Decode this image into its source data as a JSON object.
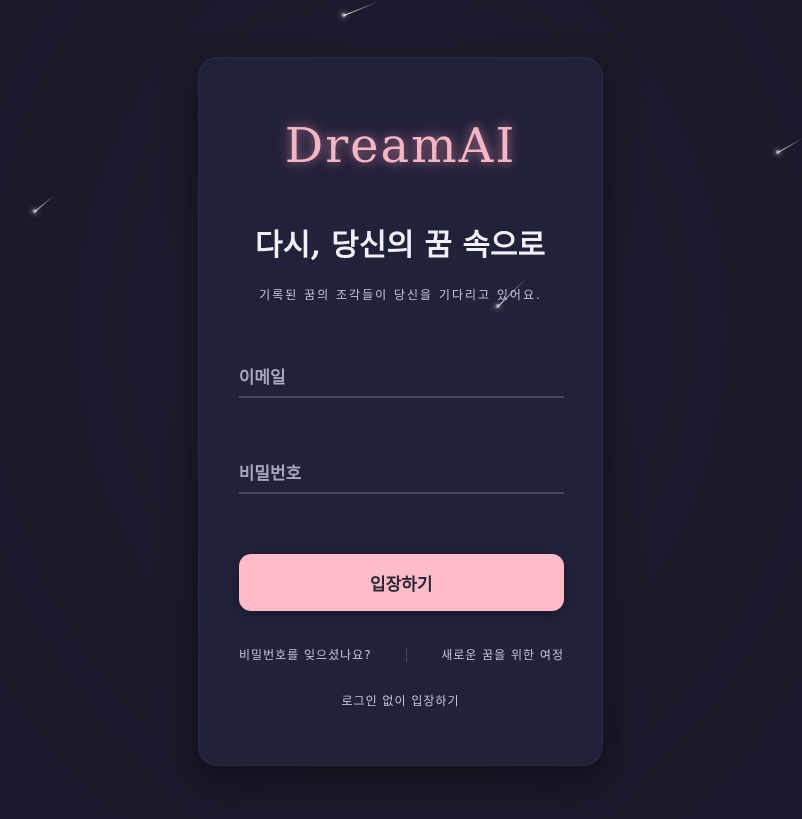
{
  "brand": {
    "name": "DreamAI",
    "color": "#f2b6c4"
  },
  "login": {
    "heading": "다시, 당신의 꿈 속으로",
    "subtitle": "기록된 꿈의 조각들이 당신을 기다리고 있어요.",
    "email_placeholder": "이메일",
    "password_placeholder": "비밀번호",
    "submit_label": "입장하기",
    "forgot_password": "비밀번호를 잊으셨나요?",
    "signup": "새로운 꿈을 위한 여정",
    "guest": "로그인 없이 입장하기"
  },
  "colors": {
    "background": "#1b1a2b",
    "card": "#22213a",
    "button": "#fdbcc8",
    "button_text": "#2b2637"
  },
  "decorations": {
    "icon": "shooting-star-icon"
  }
}
